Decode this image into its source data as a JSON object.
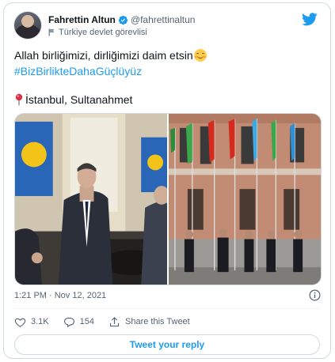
{
  "author": {
    "display_name": "Fahrettin Altun",
    "handle": "@fahrettinaltun",
    "verified": true,
    "affiliation": "Türkiye devlet görevlisi"
  },
  "tweet": {
    "line1": "Allah birliğimizi, dirliğimizi daim etsin",
    "hashtag": "#BizBirlikteDahaGüçlüyüz",
    "location": "İstanbul, Sultanahmet",
    "emoji": "smiling-face-emoji",
    "location_icon": "round-pushpin-emoji"
  },
  "meta": {
    "timestamp": "1:21 PM · Nov 12, 2021"
  },
  "actions": {
    "likes": "3.1K",
    "replies": "154",
    "share_label": "Share this Tweet"
  },
  "reply_button": "Tweet your reply",
  "colors": {
    "accent": "#1d9bf0",
    "text": "#0f1419",
    "secondary": "#536471",
    "border": "#cfd9de"
  },
  "icons": {
    "brand": "twitter-bird-icon",
    "verified": "verified-badge-icon",
    "affiliation": "flag-icon",
    "info": "info-icon",
    "like": "heart-icon",
    "reply": "reply-bubble-icon",
    "share": "share-icon"
  }
}
